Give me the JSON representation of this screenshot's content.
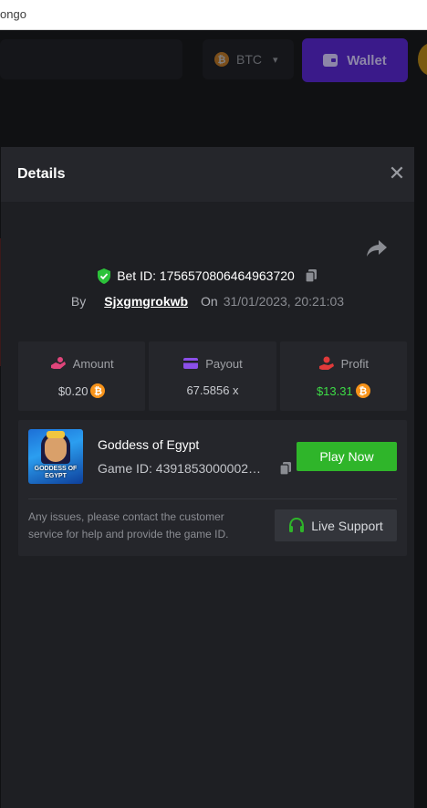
{
  "browser": {
    "url_fragment": "ongo"
  },
  "header": {
    "currency": {
      "label": "BTC",
      "icon": "bitcoin-icon"
    },
    "wallet_label": "Wallet"
  },
  "modal": {
    "title": "Details",
    "bet_id_text": "Bet ID: 1756570806464963720",
    "by_label": "By",
    "username": "Sjxgmgrokwb",
    "on_label": "On",
    "datetime": "31/01/2023, 20:21:03",
    "stats": {
      "amount": {
        "label": "Amount",
        "value": "$0.20",
        "icon": "amount-hand-icon",
        "color": "#e0457b"
      },
      "payout": {
        "label": "Payout",
        "value": "67.5856 x",
        "icon": "card-icon",
        "color": "#8b4fe8"
      },
      "profit": {
        "label": "Profit",
        "value": "$13.31",
        "icon": "profit-hand-icon",
        "color": "#e03a3a",
        "value_color": "#3ddc46"
      }
    },
    "game": {
      "name": "Goddess of Egypt",
      "id_text": "Game ID: 4391853000002…",
      "thumb_text": "GODDESS OF EGYPT",
      "play_label": "Play Now",
      "help_text": "Any issues, please contact the customer service for help and provide the game ID.",
      "support_label": "Live Support"
    }
  },
  "colors": {
    "accent_green": "#2fb52a",
    "shield_green": "#2cc23a",
    "bitcoin": "#f7931a",
    "wallet_purple": "#3a1a8a"
  }
}
